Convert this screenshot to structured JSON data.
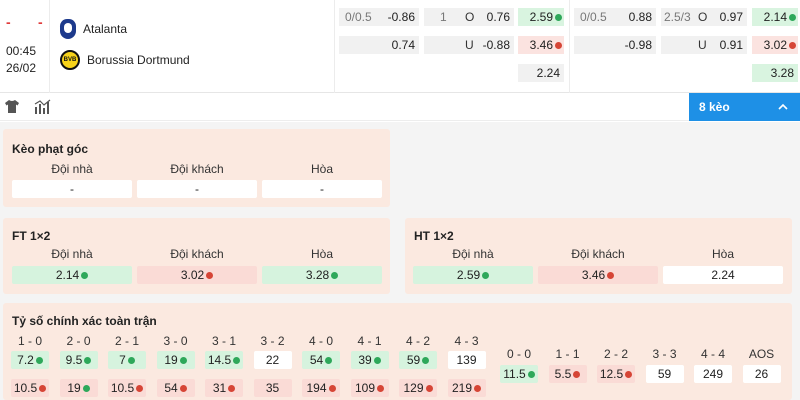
{
  "match": {
    "score_left": "-",
    "score_right": "-",
    "time": "00:45",
    "date": "26/02",
    "home_team": "Atalanta",
    "away_team": "Borussia Dortmund"
  },
  "odds_row": {
    "ah_line": "0/0.5",
    "ah_home": "-0.86",
    "ah_away": "0.74",
    "ou_line": "1",
    "ou_over_label": "O",
    "ou_under_label": "U",
    "ou_over": "0.76",
    "ou_under": "-0.88",
    "x12_home": "2.59",
    "x12_away": "3.46",
    "x12_draw": "2.24",
    "ft_ah_line": "0/0.5",
    "ft_ah_home": "0.88",
    "ft_ah_away": "-0.98",
    "ft_ou_line": "2.5/3",
    "ft_ou_over_label": "O",
    "ft_ou_under_label": "U",
    "ft_ou_over": "0.97",
    "ft_ou_under": "0.91",
    "ft_x12_home": "2.14",
    "ft_x12_away": "3.02",
    "ft_x12_draw": "3.28"
  },
  "toolbar": {
    "keo_count": "8 kèo"
  },
  "corner_panel": {
    "title": "Kèo phạt góc",
    "headers": [
      "Đội nhà",
      "Đội khách",
      "Hòa"
    ],
    "values": [
      "-",
      "-",
      "-"
    ]
  },
  "ft_panel": {
    "title": "FT 1×2",
    "headers": [
      "Đội nhà",
      "Đội khách",
      "Hòa"
    ],
    "values": [
      "2.14",
      "3.02",
      "3.28"
    ]
  },
  "ht_panel": {
    "title": "HT 1×2",
    "headers": [
      "Đội nhà",
      "Đội khách",
      "Hòa"
    ],
    "values": [
      "2.59",
      "3.46",
      "2.24"
    ]
  },
  "correct_score": {
    "title": "Tỷ số chính xác toàn trận",
    "home_scores": [
      "1 - 0",
      "2 - 0",
      "2 - 1",
      "3 - 0",
      "3 - 1",
      "3 - 2",
      "4 - 0",
      "4 - 1",
      "4 - 2",
      "4 - 3"
    ],
    "home_odds": [
      "7.2",
      "9.5",
      "7",
      "19",
      "14.5",
      "22",
      "54",
      "39",
      "59",
      "139"
    ],
    "away_odds": [
      "10.5",
      "19",
      "10.5",
      "54",
      "31",
      "35",
      "194",
      "109",
      "129",
      "219"
    ],
    "draw_scores": [
      "0 - 0",
      "1 - 1",
      "2 - 2",
      "3 - 3",
      "4 - 4",
      "AOS"
    ],
    "draw_odds": [
      "11.5",
      "5.5",
      "12.5",
      "59",
      "249",
      "26"
    ]
  },
  "colors": {
    "accent": "#1e90e6",
    "up": "#2ea85a",
    "down": "#d64536",
    "panel_bg": "#fbe9e0",
    "green_bg": "#d6f3de",
    "red_bg": "#fadbd6"
  }
}
